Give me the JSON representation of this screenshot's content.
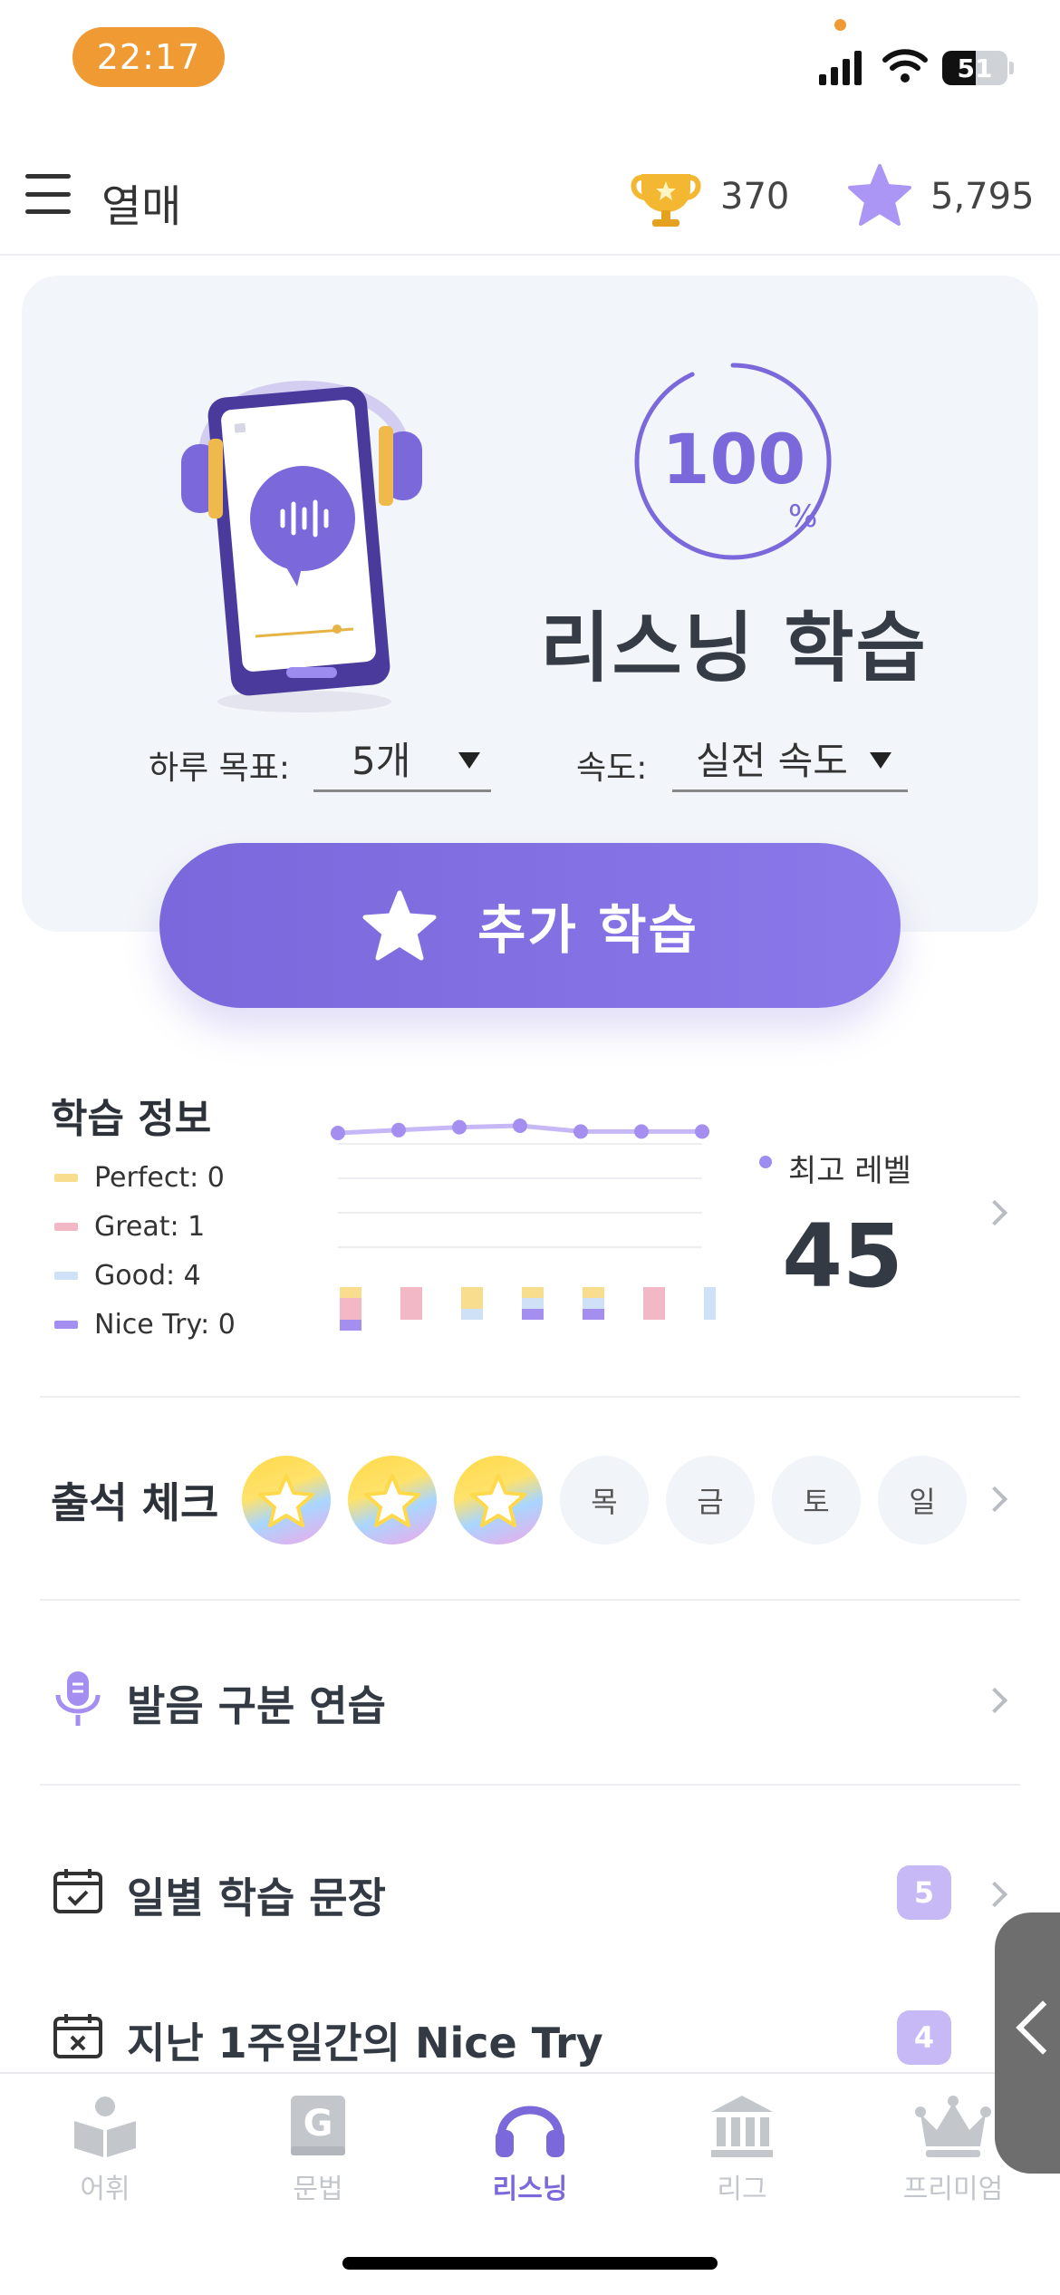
{
  "status_bar": {
    "time": "22:17",
    "battery": "51",
    "battery_level_pct": 51,
    "accent_color": "#ef9a32",
    "icons": [
      "signal-icon",
      "wifi-icon",
      "battery-icon"
    ]
  },
  "header": {
    "title": "열매",
    "trophy_count": "370",
    "star_count": "5,795",
    "icons": [
      "menu-icon",
      "trophy-icon",
      "star-icon"
    ]
  },
  "hero": {
    "progress_value": "100",
    "progress_unit": "%",
    "progress_pct": 100,
    "title": "리스닝 학습",
    "goal_label": "하루 목표:",
    "goal_value": "5개",
    "speed_label": "속도:",
    "speed_value": "실전 속도",
    "accent_color": "#7b69dc"
  },
  "cta": {
    "label": "추가 학습",
    "icon": "star-icon"
  },
  "learning_info": {
    "title": "학습 정보",
    "legend": [
      {
        "label": "Perfect: 0",
        "color": "#f9dd8f"
      },
      {
        "label": "Great: 1",
        "color": "#f2b8c6"
      },
      {
        "label": "Good: 4",
        "color": "#cfe1f6"
      },
      {
        "label": "Nice Try: 0",
        "color": "#a48ef0"
      }
    ],
    "best_level_label": "최고 레벨",
    "best_level_value": "45"
  },
  "chart_data": {
    "type": "line",
    "series": [
      {
        "values": [
          0.5,
          0.3,
          0.1,
          0.0,
          0.4,
          0.4,
          0.4
        ]
      }
    ],
    "stack_columns": [
      {
        "perfect": 1,
        "great": 2,
        "good": 0,
        "nice_try": 1
      },
      {
        "perfect": 0,
        "great": 3,
        "good": 0,
        "nice_try": 0
      },
      {
        "perfect": 2,
        "great": 0,
        "good": 1,
        "nice_try": 0
      },
      {
        "perfect": 1,
        "great": 0,
        "good": 1,
        "nice_try": 1
      },
      {
        "perfect": 1,
        "great": 0,
        "good": 1,
        "nice_try": 1
      },
      {
        "perfect": 0,
        "great": 3,
        "good": 0,
        "nice_try": 0
      },
      {
        "perfect": 0,
        "great": 0,
        "good": 3,
        "nice_try": 0
      }
    ],
    "grid": true
  },
  "attendance": {
    "title": "출석 체크",
    "days": [
      {
        "label": "",
        "done": true
      },
      {
        "label": "",
        "done": true
      },
      {
        "label": "",
        "done": true
      },
      {
        "label": "목",
        "done": false
      },
      {
        "label": "금",
        "done": false
      },
      {
        "label": "토",
        "done": false
      },
      {
        "label": "일",
        "done": false
      }
    ]
  },
  "rows": [
    {
      "label": "발음 구분 연습",
      "icon": "microphone-icon",
      "badge": ""
    },
    {
      "label": "일별 학습 문장",
      "icon": "calendar-check-icon",
      "badge": "5"
    },
    {
      "label": "지난 1주일간의 Nice Try",
      "icon": "calendar-x-icon",
      "badge": "4"
    }
  ],
  "tabs": [
    {
      "label": "어휘",
      "icon": "book-icon",
      "active": false
    },
    {
      "label": "문법",
      "icon": "grammar-g-icon",
      "active": false
    },
    {
      "label": "리스닝",
      "icon": "headphones-icon",
      "active": true
    },
    {
      "label": "리그",
      "icon": "building-icon",
      "active": false
    },
    {
      "label": "프리미엄",
      "icon": "crown-icon",
      "active": false
    }
  ]
}
